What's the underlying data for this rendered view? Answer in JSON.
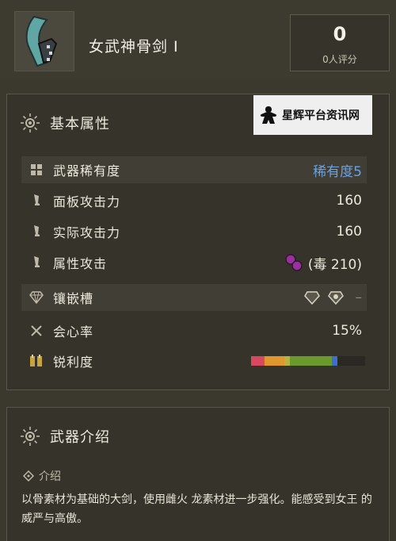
{
  "weapon": {
    "name": "女武神骨剑 I",
    "rating_value": "0",
    "rating_label": "0人评分"
  },
  "watermark": {
    "text": "星辉平台资讯网"
  },
  "attributes": {
    "title": "基本属性",
    "rows": [
      {
        "label": "武器稀有度",
        "value": "稀有度5",
        "icon": "grid-icon"
      },
      {
        "label": "面板攻击力",
        "value": "160",
        "icon": "blade-icon"
      },
      {
        "label": "实际攻击力",
        "value": "160",
        "icon": "blade-icon"
      },
      {
        "label": "属性攻击",
        "value": "(毒 210)",
        "icon": "blade-icon"
      },
      {
        "label": "镶嵌槽",
        "value": "–",
        "icon": "gem-icon"
      },
      {
        "label": "会心率",
        "value": "15%",
        "icon": "crossed-swords-icon"
      },
      {
        "label": "锐利度",
        "value": "",
        "icon": "sharpness-icon"
      }
    ]
  },
  "sharpness": [
    {
      "color": "#d9485f",
      "fraction": 0.12
    },
    {
      "color": "#e0972e",
      "fraction": 0.17
    },
    {
      "color": "#b8b33a",
      "fraction": 0.05
    },
    {
      "color": "#6a9a2e",
      "fraction": 0.37
    },
    {
      "color": "#3b6fd4",
      "fraction": 0.05
    },
    {
      "color": "#2a2822",
      "fraction": 0.24
    }
  ],
  "intro": {
    "title": "武器介绍",
    "subtitle": "介绍",
    "text": "以骨素材为基础的大剑，使用雌火 龙素材进一步强化。能感受到女王 的威严与高傲。"
  },
  "colors": {
    "rarity_blue": "#6ba3e0",
    "poison_purple": "#9b2fa0"
  }
}
